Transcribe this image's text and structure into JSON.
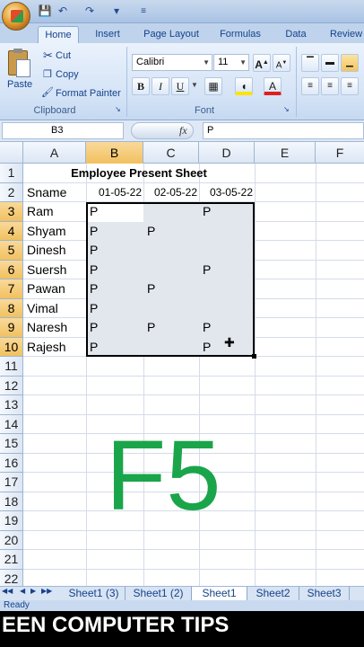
{
  "titlebar": {
    "qat_icons": [
      "save-icon",
      "undo-icon",
      "redo-icon",
      "dropdown-icon"
    ]
  },
  "ribbon": {
    "tabs": [
      "Home",
      "Insert",
      "Page Layout",
      "Formulas",
      "Data",
      "Review"
    ],
    "clipboard": {
      "paste": "Paste",
      "cut": "Cut",
      "copy": "Copy",
      "format_painter": "Format Painter",
      "label": "Clipboard"
    },
    "font": {
      "name": "Calibri",
      "size": "11",
      "bold": "B",
      "italic": "I",
      "underline": "U",
      "label": "Font"
    }
  },
  "formula_bar": {
    "name_box": "B3",
    "fx": "fx",
    "value": "P"
  },
  "columns": [
    "A",
    "B",
    "C",
    "D",
    "E",
    "F"
  ],
  "rows": [
    "1",
    "2",
    "3",
    "4",
    "5",
    "6",
    "7",
    "8",
    "9",
    "10",
    "11",
    "12",
    "13",
    "14",
    "15",
    "16",
    "17",
    "18",
    "19",
    "20",
    "21",
    "22"
  ],
  "sheet": {
    "title": "Employee Present Sheet",
    "name_header": "Sname",
    "dates": [
      "01-05-22",
      "02-05-22",
      "03-05-22"
    ],
    "employees": [
      {
        "name": "Ram",
        "d1": "P",
        "d2": "",
        "d3": "P"
      },
      {
        "name": "Shyam",
        "d1": "P",
        "d2": "P",
        "d3": ""
      },
      {
        "name": "Dinesh",
        "d1": "P",
        "d2": "",
        "d3": ""
      },
      {
        "name": "Suersh",
        "d1": "P",
        "d2": "",
        "d3": "P"
      },
      {
        "name": "Pawan",
        "d1": "P",
        "d2": "P",
        "d3": ""
      },
      {
        "name": "Vimal",
        "d1": "P",
        "d2": "",
        "d3": ""
      },
      {
        "name": "Naresh",
        "d1": "P",
        "d2": "P",
        "d3": "P"
      },
      {
        "name": "Rajesh",
        "d1": "P",
        "d2": "",
        "d3": "P"
      }
    ]
  },
  "sheet_tabs": [
    "Sheet1 (3)",
    "Sheet1 (2)",
    "Sheet1",
    "Sheet2",
    "Sheet3"
  ],
  "status": "Ready",
  "overlay": {
    "key": "F5",
    "banner": "EEN COMPUTER TIPS"
  },
  "colors": {
    "selection": "#e2e7ee",
    "key_text": "#1aa54a"
  }
}
